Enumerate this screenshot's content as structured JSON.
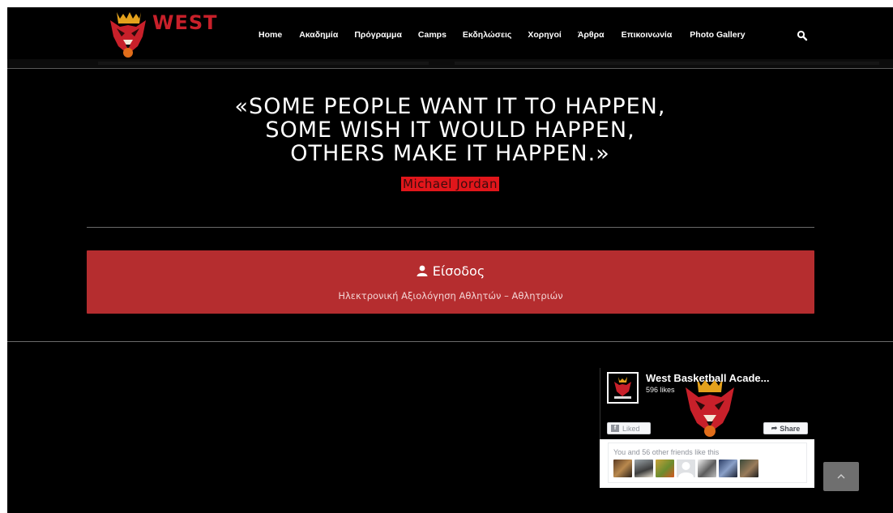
{
  "header": {
    "logo_text": "WEST",
    "nav": [
      "Home",
      "Ακαδημία",
      "Πρόγραμμα",
      "Camps",
      "Εκδηλώσεις",
      "Χορηγοί",
      "Άρθρα",
      "Επικοινωνία",
      "Photo Gallery"
    ],
    "search_icon": "search-icon"
  },
  "quote": {
    "lines": [
      "«SOME PEOPLE WANT IT TO HAPPEN,",
      "SOME WISH IT WOULD HAPPEN,",
      "OTHERS MAKE IT HAPPEN.»"
    ],
    "author": "Michael Jordan"
  },
  "login": {
    "icon": "user-icon",
    "title": "Είσοδος",
    "subtitle": "Ηλεκτρονική Αξιολόγηση Αθλητών – Αθλητριών"
  },
  "facebook": {
    "page_name": "West Basketball Acade...",
    "likes": "596 likes",
    "liked_label": "Liked",
    "share_label": "Share",
    "friends_text": "You and 56 other friends like this"
  },
  "colors": {
    "accent_red": "#b52d2f",
    "author_highlight": "#e1161b",
    "background": "#000000",
    "scroll_button": "#6f6f6f"
  }
}
